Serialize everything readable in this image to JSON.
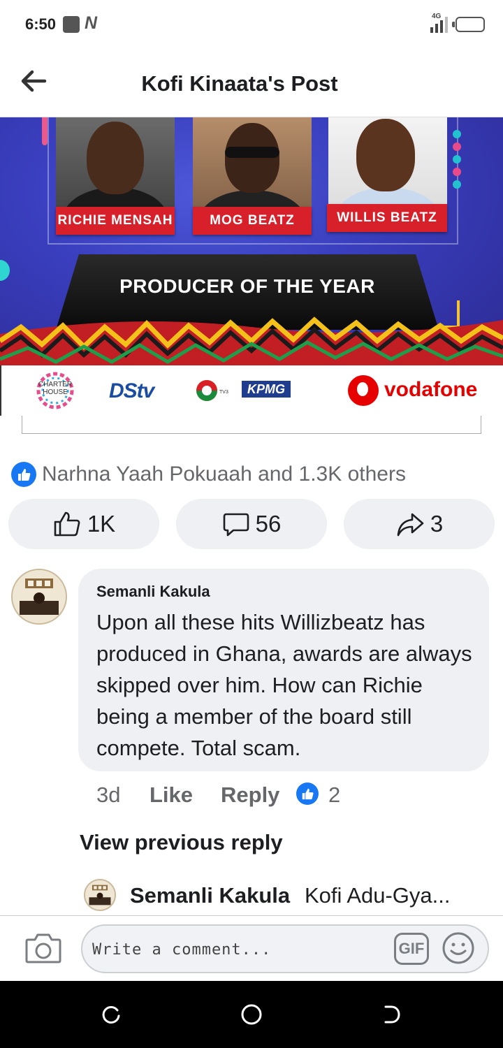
{
  "status_bar": {
    "time": "6:50",
    "network": "4G",
    "icons": [
      "notification-box-icon",
      "notification-n-icon",
      "signal-icon",
      "battery-icon"
    ]
  },
  "header": {
    "title": "Kofi Kinaata's Post",
    "back_icon": "back-arrow-icon"
  },
  "post_image": {
    "nominees": [
      {
        "name": "RICHIE MENSAH"
      },
      {
        "name": "MOG BEATZ"
      },
      {
        "name": "WILLIS BEATZ"
      }
    ],
    "award_title": "PRODUCER OF THE YEAR",
    "sponsors": {
      "charter_house": "CHARTER HOUSE",
      "dstv": "DStv",
      "tv3": "TV3",
      "kpmg": "KPMG",
      "vodafone": "vodafone"
    },
    "colors": {
      "background": "#3a3fbf",
      "name_plate": "#d8202b",
      "accent_yellow": "#f4c531"
    }
  },
  "reactions": {
    "summary": "Narhna Yaah Pokuaah and 1.3K others",
    "like_count": "1K",
    "comment_count": "56",
    "share_count": "3"
  },
  "comment": {
    "author": "Semanli Kakula",
    "text": "Upon all these hits Willizbeatz has produced in Ghana, awards are always skipped over him. How can Richie being a member of the board still compete. Total scam.",
    "age": "3d",
    "like_label": "Like",
    "reply_label": "Reply",
    "reaction_count": "2"
  },
  "view_previous_reply": "View previous reply",
  "reply_preview": {
    "author": "Semanli Kakula",
    "text": "Kofi Adu-Gya..."
  },
  "composer": {
    "placeholder": "Write a comment...",
    "gif_label": "GIF"
  },
  "colors": {
    "facebook_blue": "#1877f2",
    "secondary_text": "#65676b",
    "bubble": "#eef0f3"
  }
}
